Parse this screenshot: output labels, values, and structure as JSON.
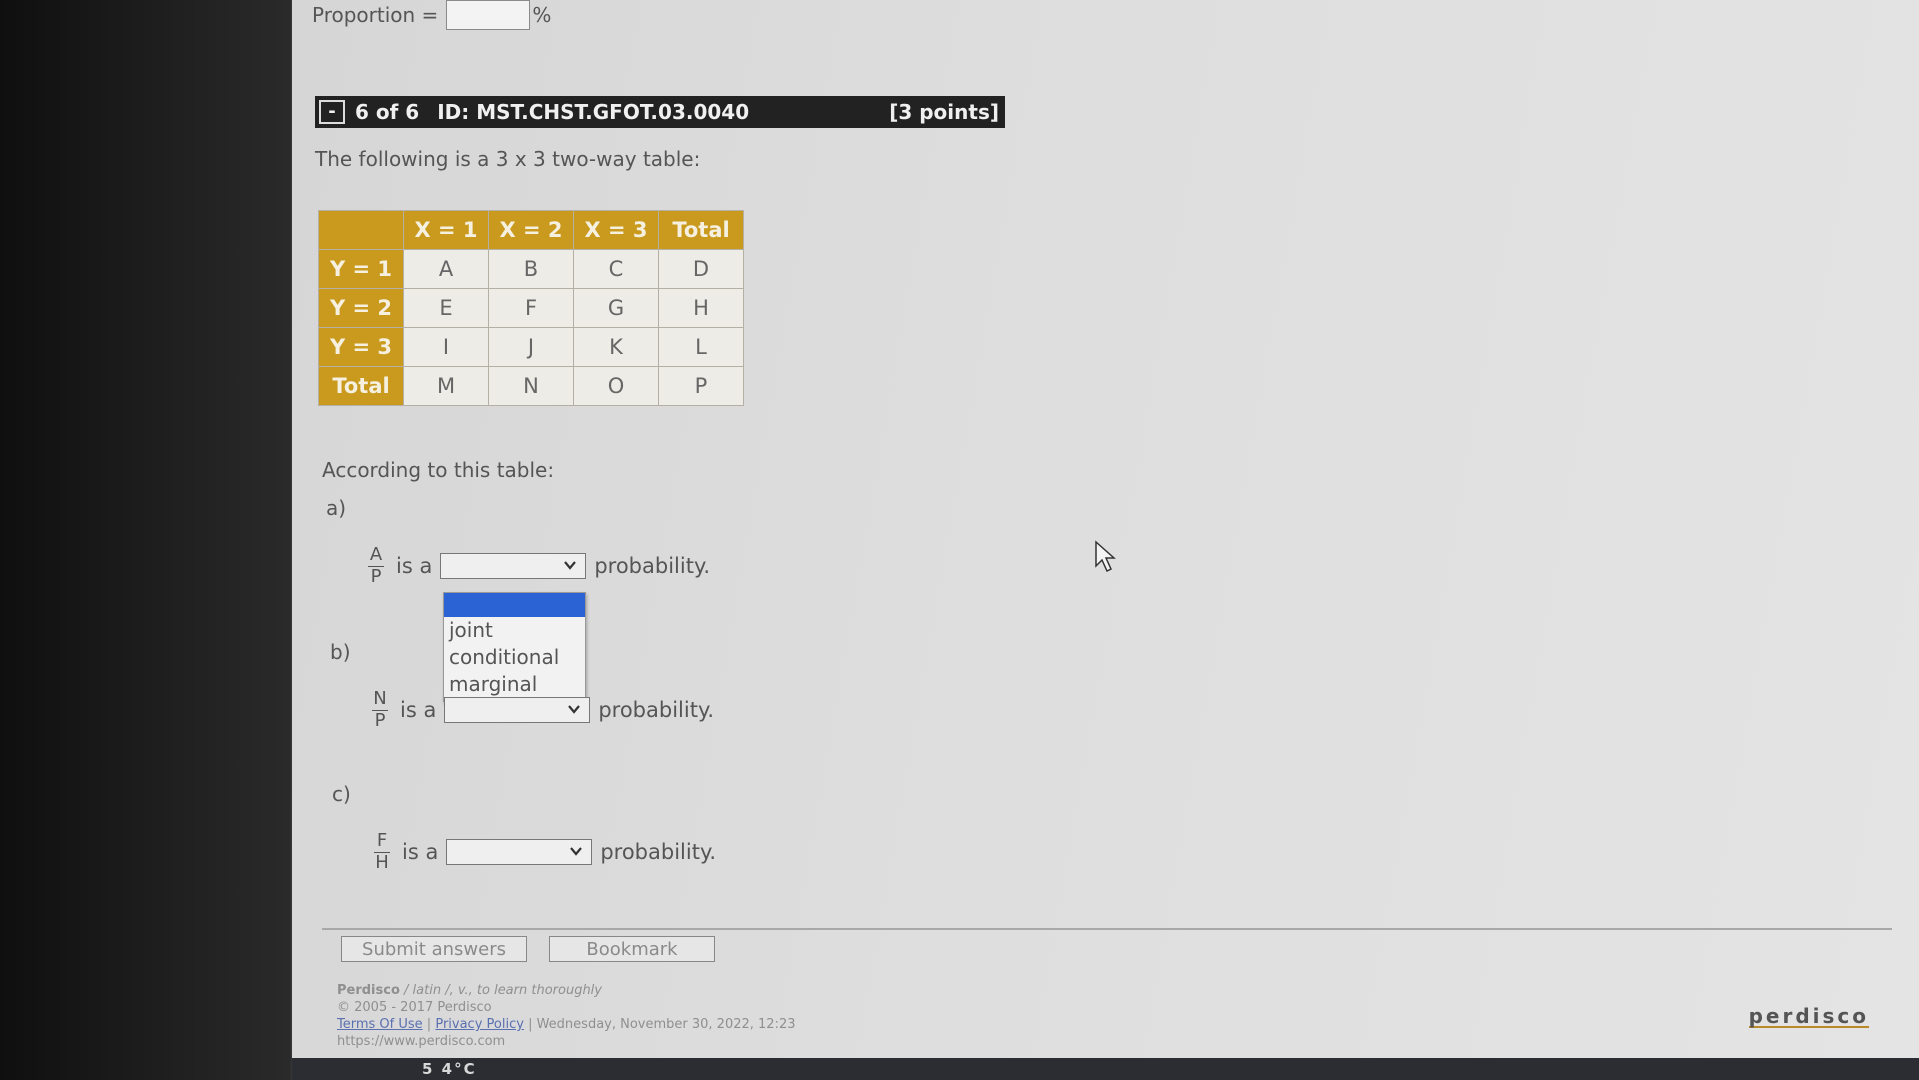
{
  "proportion": {
    "label": "Proportion =",
    "unit": "%"
  },
  "question_header": {
    "collapse": "-",
    "counter": "6 of 6",
    "id": "ID: MST.CHST.GFOT.03.0040",
    "points": "[3 points]"
  },
  "intro": "The following is a 3 x 3 two-way table:",
  "table": {
    "columns": [
      "X = 1",
      "X = 2",
      "X = 3",
      "Total"
    ],
    "rows": [
      {
        "label": "Y = 1",
        "cells": [
          "A",
          "B",
          "C",
          "D"
        ]
      },
      {
        "label": "Y = 2",
        "cells": [
          "E",
          "F",
          "G",
          "H"
        ]
      },
      {
        "label": "Y = 3",
        "cells": [
          "I",
          "J",
          "K",
          "L"
        ]
      },
      {
        "label": "Total",
        "cells": [
          "M",
          "N",
          "O",
          "P"
        ]
      }
    ]
  },
  "according": "According to this table:",
  "parts": [
    {
      "label": "a)",
      "numerator": "A",
      "denominator": "P",
      "prefix": "is a",
      "suffix": "probability."
    },
    {
      "label": "b)",
      "numerator": "N",
      "denominator": "P",
      "prefix": "is a",
      "suffix": "probability."
    },
    {
      "label": "c)",
      "numerator": "F",
      "denominator": "H",
      "prefix": "is a",
      "suffix": "probability."
    }
  ],
  "dropdown_options": [
    "joint",
    "conditional",
    "marginal"
  ],
  "buttons": {
    "submit": "Submit answers",
    "bookmark": "Bookmark"
  },
  "footer": {
    "brand": "Perdisco",
    "tagline": "/ latin /, v., to learn thoroughly",
    "copyright": "© 2005 - 2017 Perdisco",
    "terms": "Terms Of Use",
    "sep": "|",
    "privacy": "Privacy Policy",
    "datetime": "| Wednesday, November 30, 2022, 12:23",
    "url": "https://www.perdisco.com",
    "logo": "perdisco"
  },
  "taskbar": {
    "text": "5 4°C"
  },
  "colors": {
    "table_header": "#c99a1d",
    "dropdown_highlight": "#2c63d4",
    "header_bar": "#222222"
  }
}
